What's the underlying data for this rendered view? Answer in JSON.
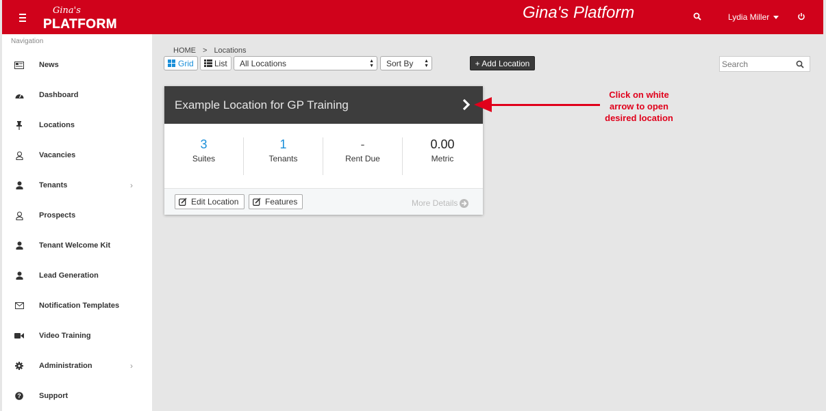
{
  "header": {
    "logo_script": "Gina's",
    "logo_word": "PLATFORM",
    "title": "Gina's Platform",
    "user_name": "Lydia Miller"
  },
  "sidebar": {
    "heading": "Navigation",
    "items": [
      {
        "label": "News",
        "icon": "newspaper-icon"
      },
      {
        "label": "Dashboard",
        "icon": "dashboard-icon"
      },
      {
        "label": "Locations",
        "icon": "pin-icon"
      },
      {
        "label": "Vacancies",
        "icon": "user-outline-icon"
      },
      {
        "label": "Tenants",
        "icon": "user-icon",
        "has_submenu": true
      },
      {
        "label": "Prospects",
        "icon": "user-outline-icon"
      },
      {
        "label": "Tenant Welcome Kit",
        "icon": "user-icon"
      },
      {
        "label": "Lead Generation",
        "icon": "user-icon"
      },
      {
        "label": "Notification Templates",
        "icon": "envelope-icon"
      },
      {
        "label": "Video Training",
        "icon": "video-camera-icon"
      },
      {
        "label": "Administration",
        "icon": "gear-icon",
        "has_submenu": true
      },
      {
        "label": "Support",
        "icon": "question-icon"
      }
    ]
  },
  "breadcrumb": {
    "home": "HOME",
    "separator": ">",
    "current": "Locations"
  },
  "toolbar": {
    "grid_label": "Grid",
    "list_label": "List",
    "locations_select": "All Locations",
    "sort_select": "Sort By",
    "add_label": "+ Add Location",
    "search_placeholder": "Search"
  },
  "card": {
    "title": "Example Location for GP Training",
    "stats": [
      {
        "value": "3",
        "label": "Suites"
      },
      {
        "value": "1",
        "label": "Tenants"
      },
      {
        "value": "-",
        "label": "Rent Due"
      },
      {
        "value": "0.00",
        "label": "Metric"
      }
    ],
    "edit_label": "Edit Location",
    "features_label": "Features",
    "more_label": "More Details"
  },
  "annotation": {
    "line1": "Click on white",
    "line2": "arrow to open",
    "line3": "desired location"
  },
  "colors": {
    "brand_red": "#d0021b",
    "link_blue": "#1a8fd9",
    "card_header": "#3d3d3d"
  }
}
